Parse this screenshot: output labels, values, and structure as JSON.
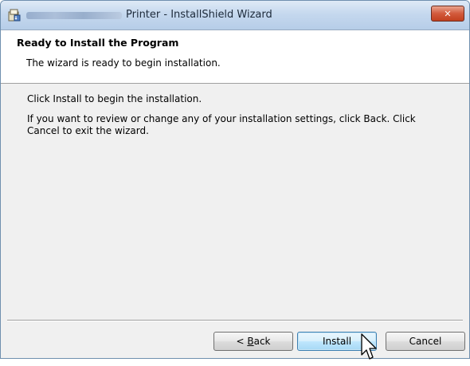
{
  "window": {
    "title": "Printer - InstallShield Wizard",
    "close_glyph": "✕"
  },
  "banner": {
    "title": "Ready to Install the Program",
    "subtitle": "The wizard is ready to begin installation."
  },
  "content": {
    "line1": "Click Install to begin the installation.",
    "line2": "If you want to review or change any of your installation settings, click Back. Click Cancel to exit the wizard."
  },
  "buttons": {
    "back_prefix": "< ",
    "back_mnemonic": "B",
    "back_rest": "ack",
    "install": "Install",
    "cancel": "Cancel"
  },
  "icons": [
    "installer-icon",
    "close-icon",
    "mouse-cursor-icon"
  ],
  "colors": {
    "titlebar": "#c5d8ee",
    "close_button": "#d25a3c",
    "default_button_border": "#3c7fb1"
  }
}
